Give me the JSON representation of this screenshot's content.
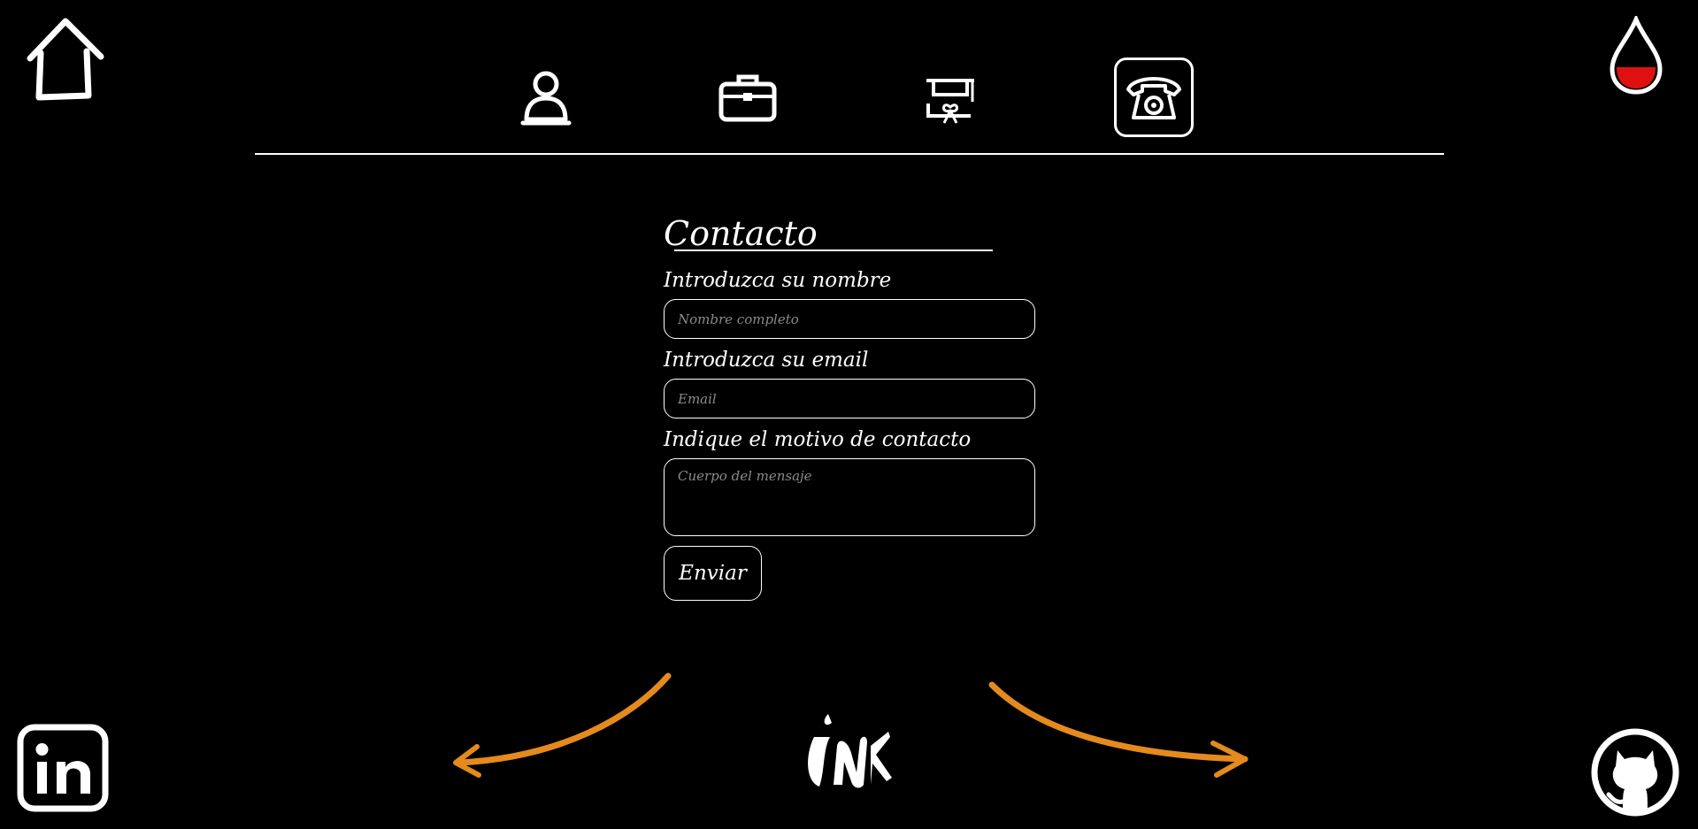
{
  "icons": {
    "home": "home-icon",
    "theme_toggle": "drop-icon",
    "linkedin": "linkedin-icon",
    "github": "github-icon",
    "logo": "ink-logo"
  },
  "nav": {
    "items": [
      {
        "name": "profile",
        "icon": "person-icon",
        "active": false
      },
      {
        "name": "experience",
        "icon": "briefcase-icon",
        "active": false
      },
      {
        "name": "education",
        "icon": "graduation-icon",
        "active": false
      },
      {
        "name": "contact",
        "icon": "telephone-icon",
        "active": true
      }
    ]
  },
  "form": {
    "title": "Contacto",
    "name_label": "Introduzca su nombre",
    "name_placeholder": "Nombre completo",
    "email_label": "Introduzca su email",
    "email_placeholder": "Email",
    "message_label": "Indique el motivo de contacto",
    "message_placeholder": "Cuerpo del mensaje",
    "submit_label": "Enviar"
  },
  "colors": {
    "background": "#000000",
    "foreground": "#ffffff",
    "accent_arrow": "#e58a1c",
    "theme_fill": "#e01010"
  }
}
